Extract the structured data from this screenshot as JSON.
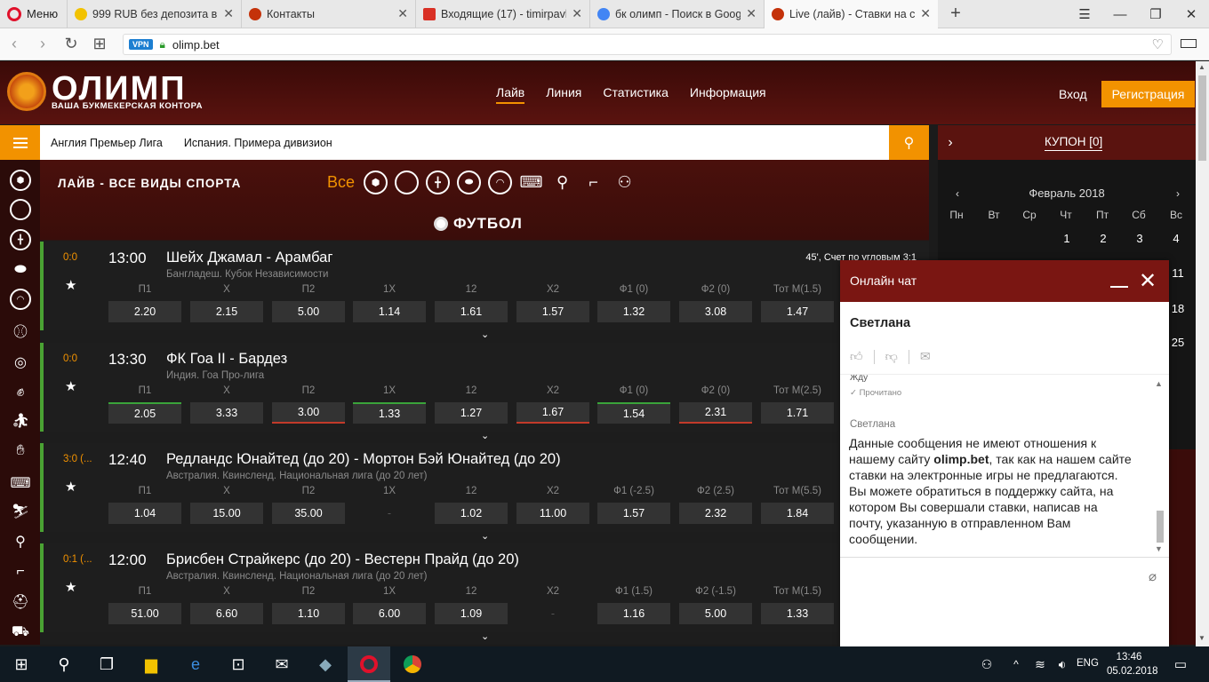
{
  "browser": {
    "menu_label": "Меню",
    "tabs": [
      {
        "title": "999 RUB без депозита в ск",
        "color": "#f2c200"
      },
      {
        "title": "Контакты",
        "color": "#c4320a"
      },
      {
        "title": "Входящие (17) - timirpavl",
        "color": "#d93025"
      },
      {
        "title": "бк олимп - Поиск в Goog",
        "color": "#4285f4"
      },
      {
        "title": "Live (лайв) - Ставки на сп",
        "color": "#c4320a"
      }
    ],
    "new_tab": "+",
    "vpn": "VPN",
    "url": "olimp.bet"
  },
  "site": {
    "logo": "ОЛИМП",
    "logo_sub": "ВАША БУКМЕКЕРСКАЯ КОНТОРА",
    "nav": [
      "Лайв",
      "Линия",
      "Статистика",
      "Информация"
    ],
    "login": "Вход",
    "register": "Регистрация",
    "leagues": [
      "Англия Премьер Лига",
      "Испания. Примера дивизион"
    ],
    "coupon": "КУПОН [0]",
    "live_title": "ЛАЙВ - ВСЕ ВИДЫ СПОРТА",
    "filter_all": "Все",
    "section": "ФУТБОЛ"
  },
  "columns": [
    "П1",
    "Х",
    "П2",
    "1Х",
    "12",
    "Х2"
  ],
  "matches": [
    {
      "score": "0:0",
      "time": "13:00",
      "teams": "Шейх Джамал - Арамбаг",
      "league": "Бангладеш. Кубок Независимости",
      "extra": "45', Счет по угловым 3:1",
      "labels": [
        "П1",
        "Х",
        "П2",
        "1Х",
        "12",
        "Х2",
        "Ф1 (0)",
        "Ф2 (0)",
        "Тот М(1.5)"
      ],
      "odds": [
        "2.20",
        "2.15",
        "5.00",
        "1.14",
        "1.61",
        "1.57",
        "1.32",
        "3.08",
        "1.47"
      ]
    },
    {
      "score": "0:0",
      "time": "13:30",
      "teams": "ФК Гоа II - Бардез",
      "league": "Индия. Гоа Про-лига",
      "extra": "",
      "labels": [
        "П1",
        "Х",
        "П2",
        "1Х",
        "12",
        "Х2",
        "Ф1 (0)",
        "Ф2 (0)",
        "Тот М(2.5)"
      ],
      "odds": [
        "2.05",
        "3.33",
        "3.00",
        "1.33",
        "1.27",
        "1.67",
        "1.54",
        "2.31",
        "1.71"
      ]
    },
    {
      "score": "3:0 (...",
      "time": "12:40",
      "teams": "Редландс Юнайтед (до 20) - Мортон Бэй Юнайтед (до 20)",
      "league": "Австралия. Квинсленд. Национальная лига (до 20 лет)",
      "extra": "",
      "labels": [
        "П1",
        "Х",
        "П2",
        "1Х",
        "12",
        "Х2",
        "Ф1 (-2.5)",
        "Ф2 (2.5)",
        "Тот М(5.5)"
      ],
      "odds": [
        "1.04",
        "15.00",
        "35.00",
        "-",
        "1.02",
        "11.00",
        "1.57",
        "2.32",
        "1.84"
      ]
    },
    {
      "score": "0:1 (...",
      "time": "12:00",
      "teams": "Брисбен Страйкерс (до 20) - Вестерн Прайд (до 20)",
      "league": "Австралия. Квинсленд. Национальная лига (до 20 лет)",
      "extra": "",
      "labels": [
        "П1",
        "Х",
        "П2",
        "1Х",
        "12",
        "Х2",
        "Ф1 (1.5)",
        "Ф2 (-1.5)",
        "Тот М(1.5)"
      ],
      "odds": [
        "51.00",
        "6.60",
        "1.10",
        "6.00",
        "1.09",
        "-",
        "1.16",
        "5.00",
        "1.33"
      ]
    }
  ],
  "calendar": {
    "month": "Февраль 2018",
    "dow": [
      "Пн",
      "Вт",
      "Ср",
      "Чт",
      "Пт",
      "Сб",
      "Вс"
    ],
    "days_row1": [
      "1",
      "2",
      "3",
      "4"
    ],
    "visible_days": [
      "11",
      "18",
      "25"
    ]
  },
  "chat": {
    "title": "Онлайн чат",
    "agent": "Светлана",
    "cut_line": "Жду",
    "read_status": "✓ Прочитано",
    "author": "Светлана",
    "message_before": "Данные сообщения не имеют отношения к нашему сайту ",
    "message_bold": "olimp.bet",
    "message_after": ", так как на нашем сайте ставки на электронные игры не предлагаются. Вы можете обратиться в поддержку сайта, на котором Вы совершали ставки, написав на почту, указанную в отправленном Вам сообщении."
  },
  "taskbar": {
    "lang": "ENG",
    "time": "13:46",
    "date": "05.02.2018"
  }
}
